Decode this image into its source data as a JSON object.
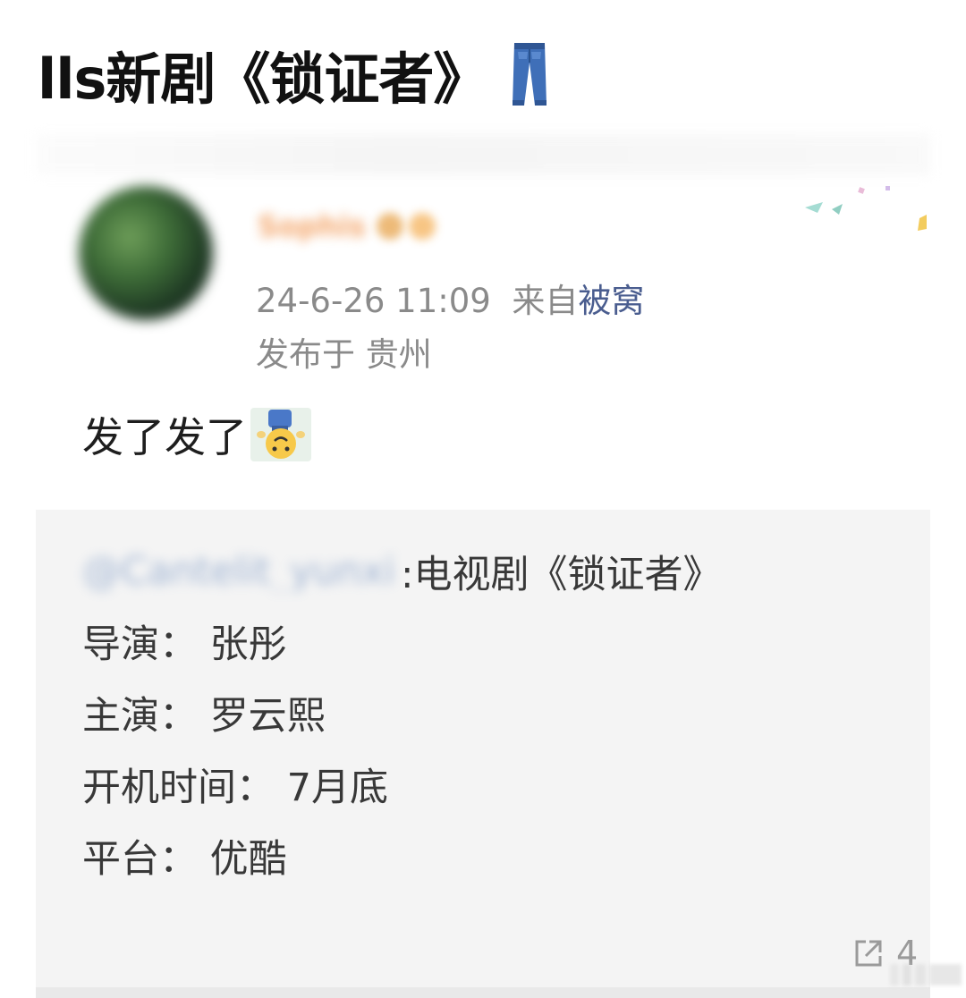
{
  "headline": {
    "title": "lls新剧《锁证者》",
    "icon": "jeans-icon"
  },
  "post": {
    "author_name": "Sophis",
    "timestamp": "24-6-26 11:09",
    "source_prefix": "来自",
    "source": "被窝",
    "location": "发布于 贵州",
    "text": "发了发了",
    "emoji": "upside-down-face-icon"
  },
  "repost": {
    "username": "@Cantelit_yunxi",
    "title": ":电视剧《锁证者》",
    "lines": [
      "导演：  张彤",
      "主演：  罗云熙",
      "开机时间：  7月底",
      "平台：  优酷"
    ]
  },
  "actions": {
    "share_icon": "share-icon",
    "share_count": "4"
  }
}
